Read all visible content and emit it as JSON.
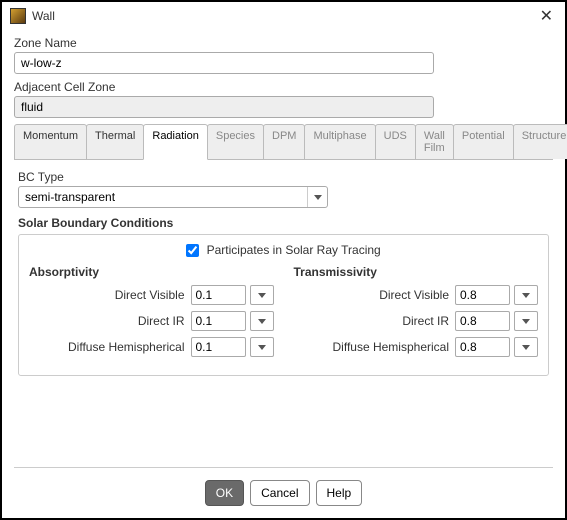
{
  "window": {
    "title": "Wall"
  },
  "zone": {
    "label": "Zone Name",
    "value": "w-low-z"
  },
  "adjacent": {
    "label": "Adjacent Cell Zone",
    "value": "fluid"
  },
  "tabs": [
    {
      "label": "Momentum",
      "enabled": true,
      "active": false
    },
    {
      "label": "Thermal",
      "enabled": true,
      "active": false
    },
    {
      "label": "Radiation",
      "enabled": true,
      "active": true
    },
    {
      "label": "Species",
      "enabled": false,
      "active": false
    },
    {
      "label": "DPM",
      "enabled": false,
      "active": false
    },
    {
      "label": "Multiphase",
      "enabled": false,
      "active": false
    },
    {
      "label": "UDS",
      "enabled": false,
      "active": false
    },
    {
      "label": "Wall Film",
      "enabled": false,
      "active": false
    },
    {
      "label": "Potential",
      "enabled": false,
      "active": false
    },
    {
      "label": "Structure",
      "enabled": false,
      "active": false
    }
  ],
  "bc": {
    "label": "BC Type",
    "value": "semi-transparent"
  },
  "solar": {
    "title": "Solar Boundary Conditions",
    "check_label": "Participates in Solar Ray Tracing",
    "checked": true,
    "absorptivity": {
      "title": "Absorptivity",
      "rows": [
        {
          "label": "Direct Visible",
          "value": "0.1"
        },
        {
          "label": "Direct IR",
          "value": "0.1"
        },
        {
          "label": "Diffuse Hemispherical",
          "value": "0.1"
        }
      ]
    },
    "transmissivity": {
      "title": "Transmissivity",
      "rows": [
        {
          "label": "Direct Visible",
          "value": "0.8"
        },
        {
          "label": "Direct IR",
          "value": "0.8"
        },
        {
          "label": "Diffuse Hemispherical",
          "value": "0.8"
        }
      ]
    }
  },
  "footer": {
    "ok": "OK",
    "cancel": "Cancel",
    "help": "Help"
  }
}
